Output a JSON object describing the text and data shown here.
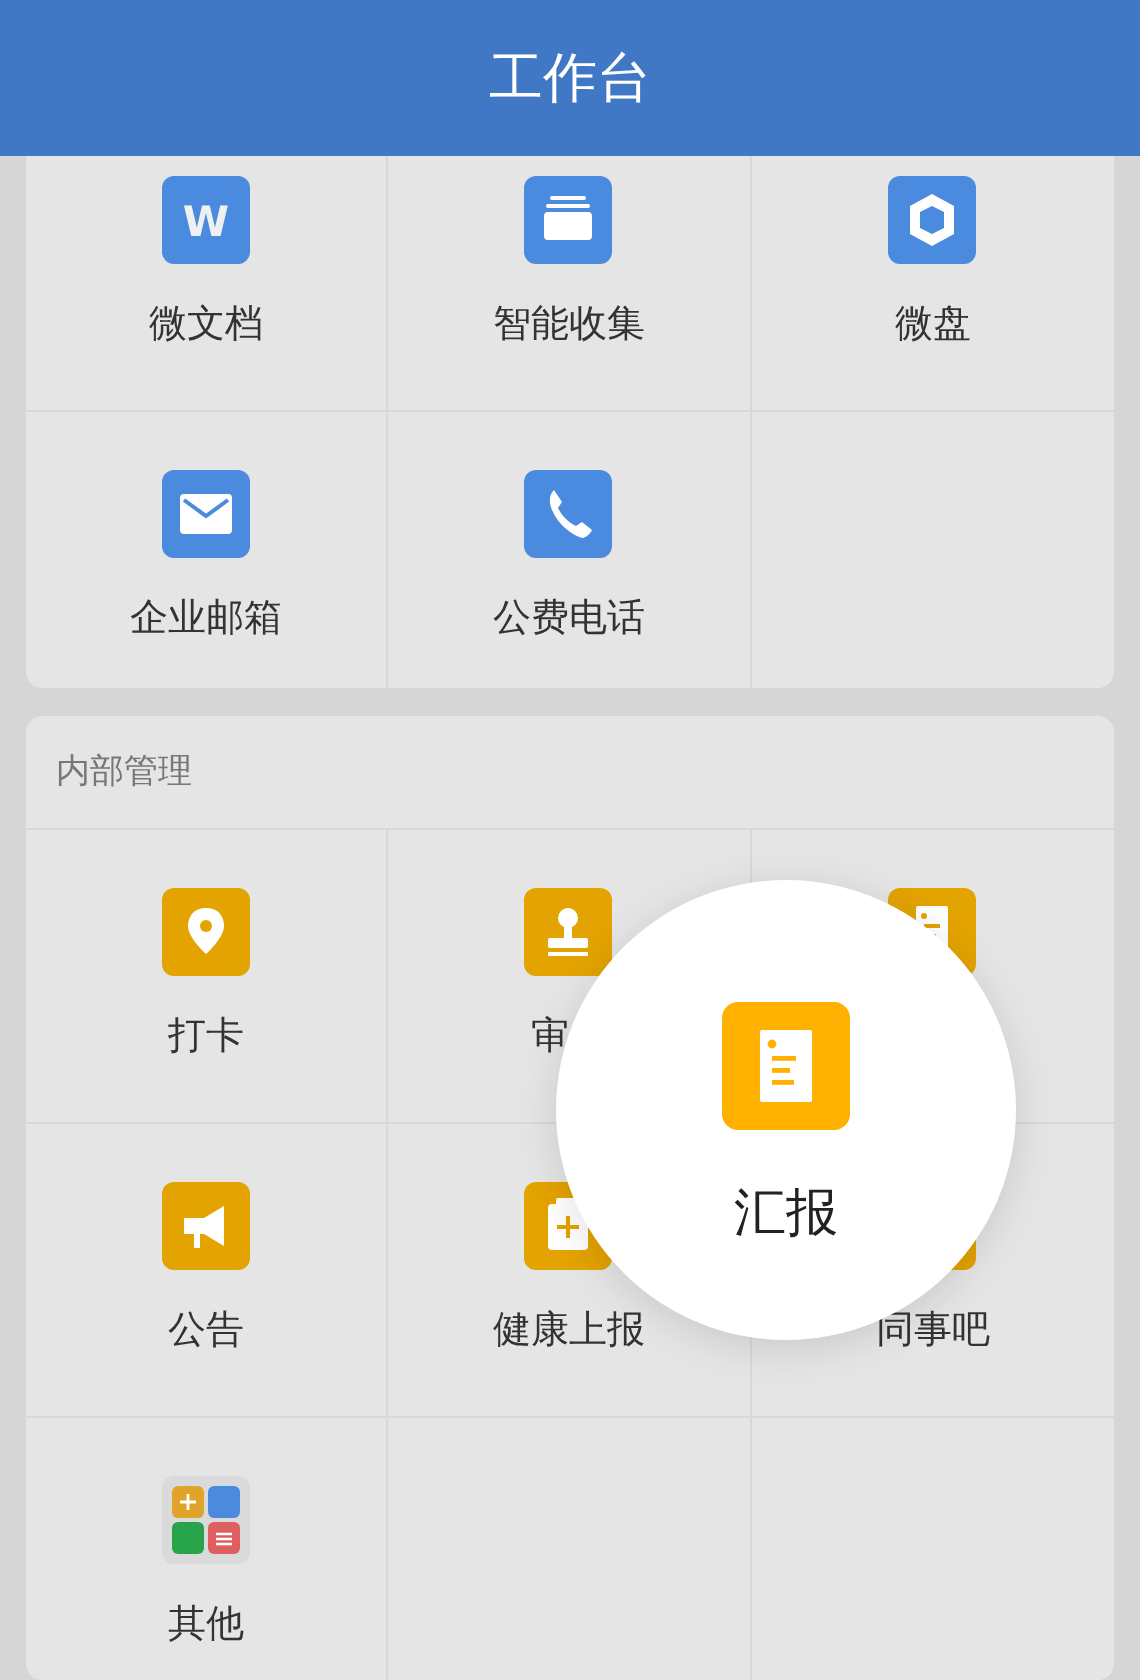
{
  "header": {
    "title": "工作台"
  },
  "sections": [
    {
      "items": [
        {
          "kind": "app",
          "label": "微文档",
          "icon_text": "W"
        },
        {
          "kind": "app",
          "label": "智能收集"
        },
        {
          "kind": "app",
          "label": "微盘"
        },
        {
          "kind": "app",
          "label": "企业邮箱"
        },
        {
          "kind": "app",
          "label": "公费电话"
        }
      ]
    },
    {
      "title": "内部管理",
      "items": [
        {
          "kind": "app",
          "label": "打卡"
        },
        {
          "kind": "app",
          "label": "审"
        },
        {
          "kind": "app"
        },
        {
          "kind": "app",
          "label": "公告"
        },
        {
          "kind": "app",
          "label": "健康上报"
        },
        {
          "kind": "app",
          "label": "同事吧"
        },
        {
          "kind": "app",
          "label": "其他"
        }
      ]
    }
  ],
  "spotlight": {
    "label": "汇报"
  }
}
